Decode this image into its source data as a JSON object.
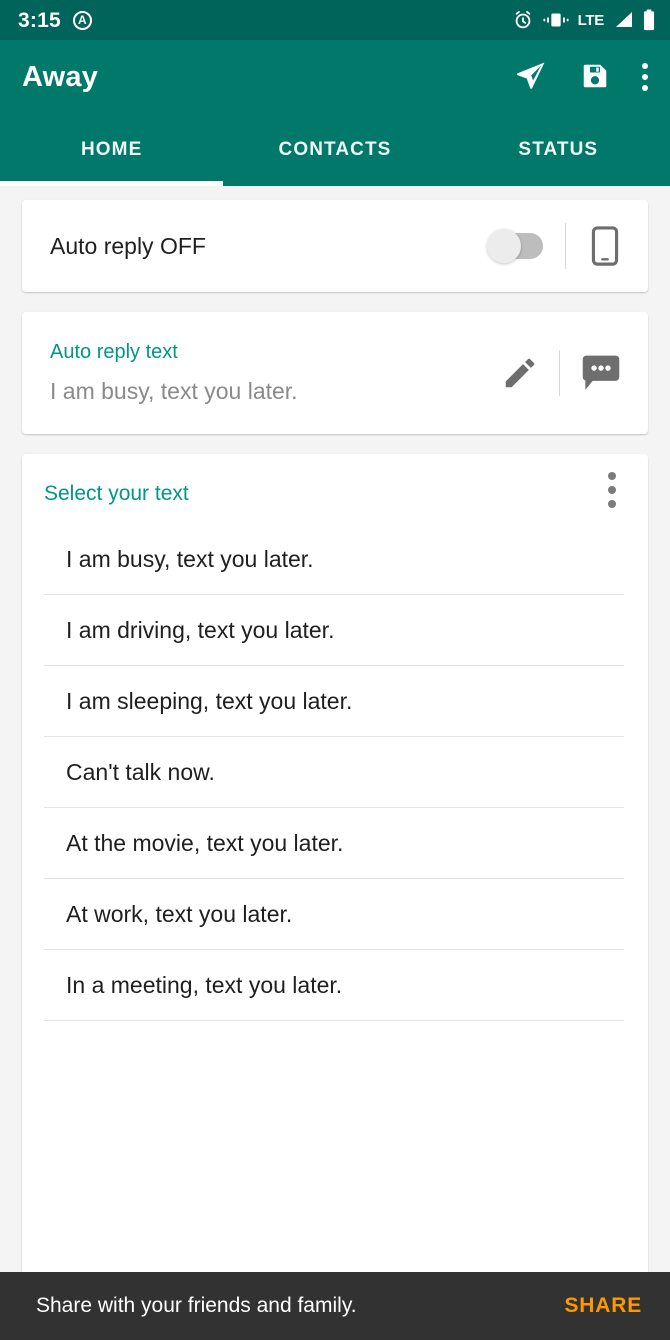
{
  "status_bar": {
    "time": "3:15",
    "mode_badge": "A",
    "network": "LTE",
    "icons": [
      "alarm-icon",
      "vibrate-icon",
      "signal-icon",
      "battery-icon"
    ]
  },
  "app_bar": {
    "title": "Away",
    "actions": [
      {
        "name": "send-icon",
        "label": "Send"
      },
      {
        "name": "save-icon",
        "label": "Save"
      },
      {
        "name": "overflow-menu-icon",
        "label": "More options"
      }
    ]
  },
  "tabs": {
    "items": [
      {
        "label": "HOME",
        "active": true
      },
      {
        "label": "CONTACTS",
        "active": false
      },
      {
        "label": "STATUS",
        "active": false
      }
    ]
  },
  "auto_reply_card": {
    "label": "Auto reply OFF",
    "switch_state": "off",
    "device_icon": "phone-icon"
  },
  "auto_reply_text_card": {
    "label": "Auto reply text",
    "value": "I am busy, text you later.",
    "edit_icon": "pencil-icon",
    "message_icon": "chat-bubble-icon"
  },
  "select_text_card": {
    "label": "Select your text",
    "overflow_icon": "overflow-menu-icon",
    "items": [
      "I am busy, text you later.",
      "I am driving, text you later.",
      "I am sleeping, text you later.",
      "Can't talk now.",
      "At the movie, text you later.",
      "At work, text you later.",
      "In a meeting, text you later."
    ]
  },
  "snackbar": {
    "message": "Share with your friends and family.",
    "action": "SHARE"
  },
  "colors": {
    "status_bar": "#00645a",
    "app_bar": "#00796b",
    "accent_teal": "#009688",
    "page_background": "#f4f4f4",
    "card": "#ffffff",
    "snackbar_background": "#323232",
    "snackbar_action": "#ff9800"
  }
}
